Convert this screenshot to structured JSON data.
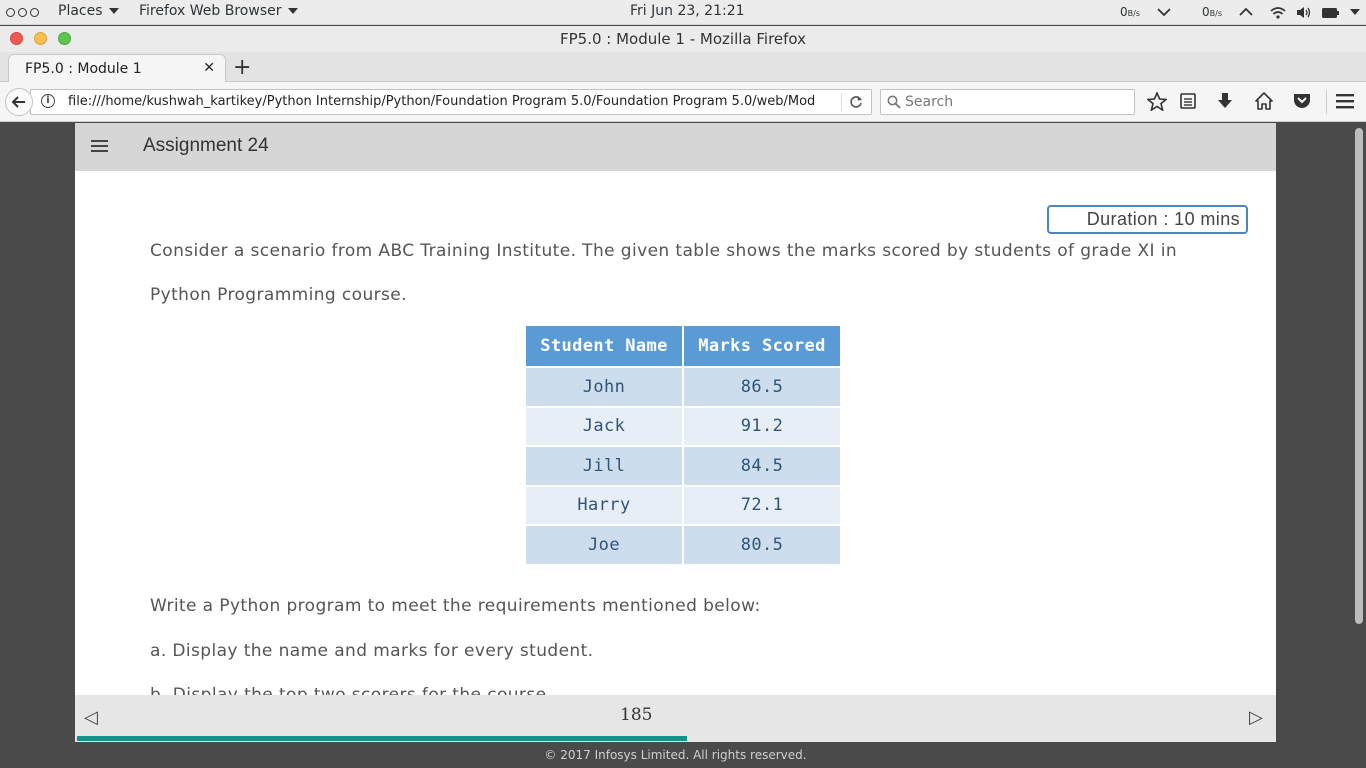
{
  "system_bar": {
    "places_label": "Places",
    "app_label": "Firefox Web Browser",
    "clock": "Fri Jun 23, 21:21",
    "net_down": "0",
    "net_down_unit": "B/s",
    "net_up": "0",
    "net_up_unit": "B/s"
  },
  "window": {
    "title": "FP5.0 : Module 1 - Mozilla Firefox"
  },
  "tabs": [
    {
      "label": "FP5.0 : Module 1"
    }
  ],
  "navbar": {
    "url": "file:///home/kushwah_kartikey/Python Internship/Python/Foundation Program 5.0/Foundation Program 5.0/web/Mod",
    "search_placeholder": "Search"
  },
  "app": {
    "title": "Assignment 24",
    "duration": "Duration : 10 mins",
    "intro_line1": "Consider a scenario from ABC Training Institute. The given table shows the marks scored by students of grade XI in",
    "intro_line2": "Python Programming course.",
    "table": {
      "headers": [
        "Student Name",
        "Marks Scored"
      ],
      "rows": [
        [
          "John",
          "86.5"
        ],
        [
          "Jack",
          "91.2"
        ],
        [
          "Jill",
          "84.5"
        ],
        [
          "Harry",
          "72.1"
        ],
        [
          "Joe",
          "80.5"
        ]
      ]
    },
    "instruction": "Write a Python program to meet the requirements mentioned below:",
    "req_a": "a. Display the name and marks for every student.",
    "req_b": "b. Display the top two scorers for the course.",
    "page_number": "185",
    "progress_percent": 51,
    "copyright": "© 2017 Infosys Limited. All rights reserved."
  },
  "colors": {
    "table_header": "#5b9bd5",
    "table_row_odd": "#cdddee",
    "table_row_even": "#e8eef6",
    "progress": "#15938a",
    "duration_border": "#4f86b5"
  }
}
